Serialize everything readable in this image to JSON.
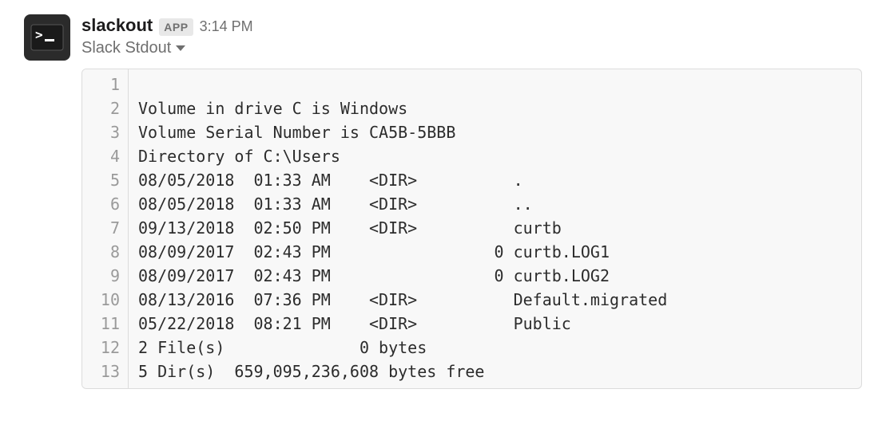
{
  "message": {
    "sender": "slackout",
    "app_badge": "APP",
    "timestamp": "3:14 PM"
  },
  "snippet": {
    "filename": "Slack Stdout",
    "lines": [
      "",
      "Volume in drive C is Windows",
      "Volume Serial Number is CA5B-5BBB",
      "Directory of C:\\Users",
      "08/05/2018  01:33 AM    <DIR>          .",
      "08/05/2018  01:33 AM    <DIR>          ..",
      "09/13/2018  02:50 PM    <DIR>          curtb",
      "08/09/2017  02:43 PM                 0 curtb.LOG1",
      "08/09/2017  02:43 PM                 0 curtb.LOG2",
      "08/13/2016  07:36 PM    <DIR>          Default.migrated",
      "05/22/2018  08:21 PM    <DIR>          Public",
      "2 File(s)              0 bytes",
      "5 Dir(s)  659,095,236,608 bytes free"
    ]
  }
}
